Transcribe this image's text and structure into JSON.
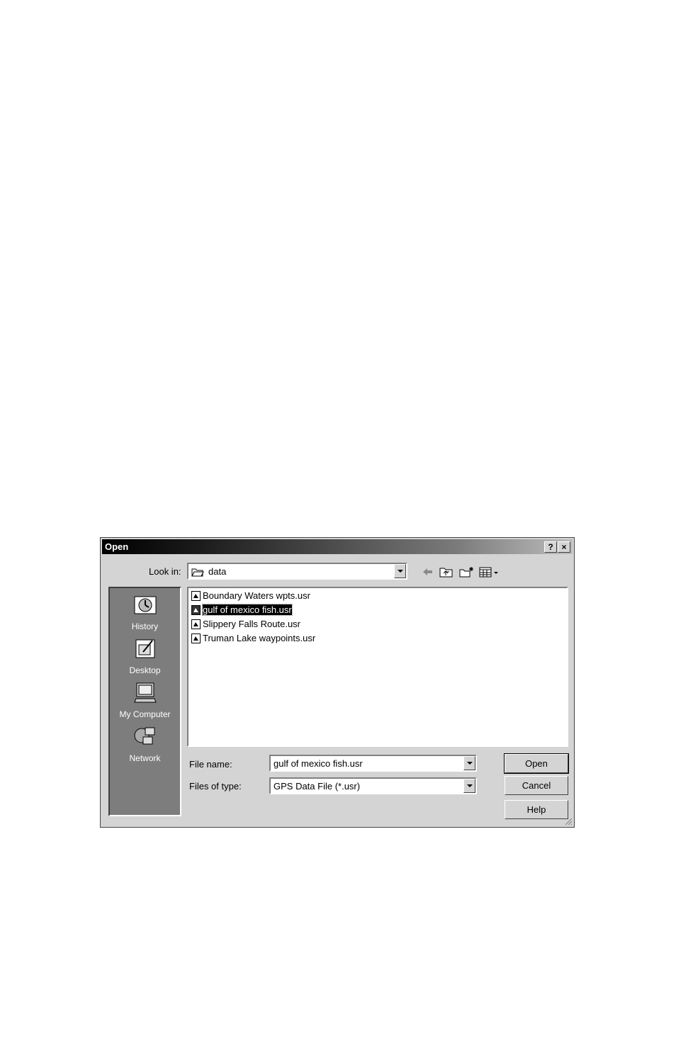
{
  "dialog": {
    "title": "Open",
    "help_button": "?",
    "close_button": "×"
  },
  "look_in": {
    "label": "Look in:",
    "value": "data"
  },
  "places": [
    {
      "label": "History",
      "icon": "history-icon"
    },
    {
      "label": "Desktop",
      "icon": "desktop-icon"
    },
    {
      "label": "My Computer",
      "icon": "my-computer-icon"
    },
    {
      "label": "Network",
      "icon": "network-icon"
    }
  ],
  "files": [
    {
      "name": "Boundary Waters wpts.usr",
      "selected": false
    },
    {
      "name": "gulf of mexico fish.usr",
      "selected": true
    },
    {
      "name": "Slippery Falls Route.usr",
      "selected": false
    },
    {
      "name": "Truman Lake waypoints.usr",
      "selected": false
    }
  ],
  "file_name": {
    "label": "File name:",
    "value": "gulf of mexico fish.usr"
  },
  "file_type": {
    "label": "Files of type:",
    "value": "GPS Data File (*.usr)"
  },
  "buttons": {
    "open": "Open",
    "cancel": "Cancel",
    "help": "Help"
  },
  "toolbar_icons": [
    "back-icon",
    "up-folder-icon",
    "new-folder-icon",
    "view-menu-icon"
  ]
}
